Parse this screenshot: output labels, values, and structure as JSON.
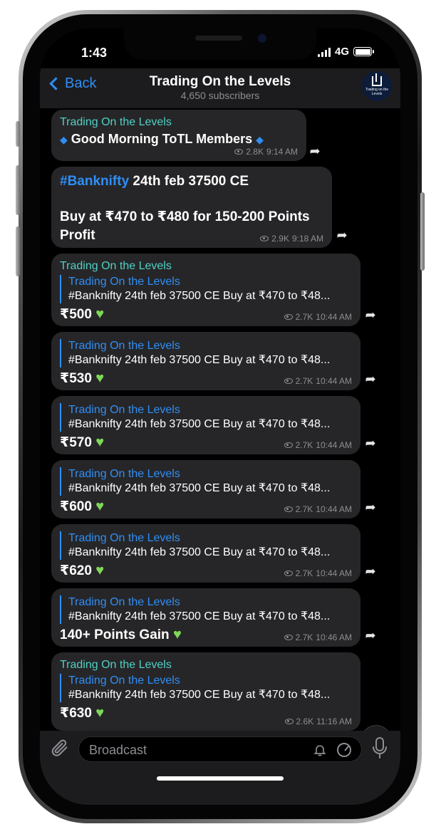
{
  "status": {
    "time": "1:43",
    "network": "4G"
  },
  "header": {
    "back_label": "Back",
    "title": "Trading On the Levels",
    "subtitle": "4,650 subscribers",
    "avatar_text": "Trading on the Levels"
  },
  "messages": [
    {
      "sender": "Trading On the Levels",
      "text": "Good Morning ToTL Members",
      "views": "2.8K",
      "time": "9:14 AM"
    },
    {
      "hashtag": "#Banknifty",
      "line1": " 24th feb 37500 CE",
      "line2": "Buy at ₹470 to ₹480 for 150-200 Points",
      "line3": "Profit",
      "views": "2.9K",
      "time": "9:18 AM"
    },
    {
      "sender": "Trading On the Levels",
      "reply_name": "Trading On the Levels",
      "reply_text": "#Banknifty 24th feb 37500 CE  Buy at ₹470 to ₹48...",
      "text": "₹500",
      "views": "2.7K",
      "time": "10:44 AM"
    },
    {
      "reply_name": "Trading On the Levels",
      "reply_text": "#Banknifty 24th feb 37500 CE  Buy at ₹470 to ₹48...",
      "text": "₹530",
      "views": "2.7K",
      "time": "10:44 AM"
    },
    {
      "reply_name": "Trading On the Levels",
      "reply_text": "#Banknifty 24th feb 37500 CE  Buy at ₹470 to ₹48...",
      "text": "₹570",
      "views": "2.7K",
      "time": "10:44 AM"
    },
    {
      "reply_name": "Trading On the Levels",
      "reply_text": "#Banknifty 24th feb 37500 CE  Buy at ₹470 to ₹48...",
      "text": "₹600",
      "views": "2.7K",
      "time": "10:44 AM"
    },
    {
      "reply_name": "Trading On the Levels",
      "reply_text": "#Banknifty 24th feb 37500 CE  Buy at ₹470 to ₹48...",
      "text": "₹620",
      "views": "2.7K",
      "time": "10:44 AM"
    },
    {
      "reply_name": "Trading On the Levels",
      "reply_text": "#Banknifty 24th feb 37500 CE  Buy at ₹470 to ₹48...",
      "text": "140+ Points Gain",
      "views": "2.7K",
      "time": "10:46 AM"
    },
    {
      "sender": "Trading On the Levels",
      "reply_name": "Trading On the Levels",
      "reply_text": "#Banknifty 24th feb 37500 CE  Buy at ₹470 to ₹48...",
      "text": "₹630",
      "views": "2.6K",
      "time": "11:16 AM"
    }
  ],
  "input": {
    "placeholder": "Broadcast"
  },
  "colors": {
    "accent": "#2f8ef6",
    "sender": "#4fd1c5",
    "bubble": "#262628",
    "heart": "#7ed957"
  }
}
